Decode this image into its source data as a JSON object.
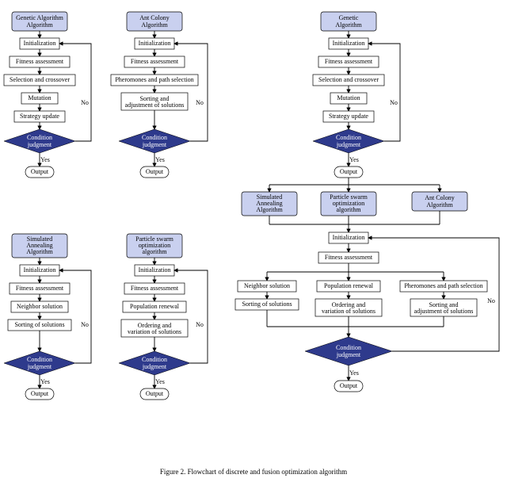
{
  "caption": "Figure 2.    Flowchart of discrete and fusion optimization algorithm",
  "common": {
    "init": "Initialization",
    "fitness": "Fitness assessment",
    "cond": "Condition judgment",
    "yes": "Yes",
    "no": "No",
    "out": "Output"
  },
  "ga": {
    "title": "Genetic Algorithm",
    "s3": "Selection and crossover",
    "s4": "Mutation",
    "s5": "Strategy update"
  },
  "aco": {
    "title": "Ant Colony Algorithm",
    "s3a": "Pheromones and path selection",
    "s4a": "Sorting and",
    "s4b": "adjustment of solutions"
  },
  "sa": {
    "title1": "Simulated",
    "title2": "Annealing",
    "title3": "Algorithm",
    "s3": "Neighbor solution",
    "s4": "Sorting of solutions"
  },
  "pso": {
    "title1": "Particle swarm",
    "title2": "optimization",
    "title3": "algorithm",
    "s3": "Population renewal",
    "s4a": "Ordering and",
    "s4b": "variation of solutions"
  }
}
